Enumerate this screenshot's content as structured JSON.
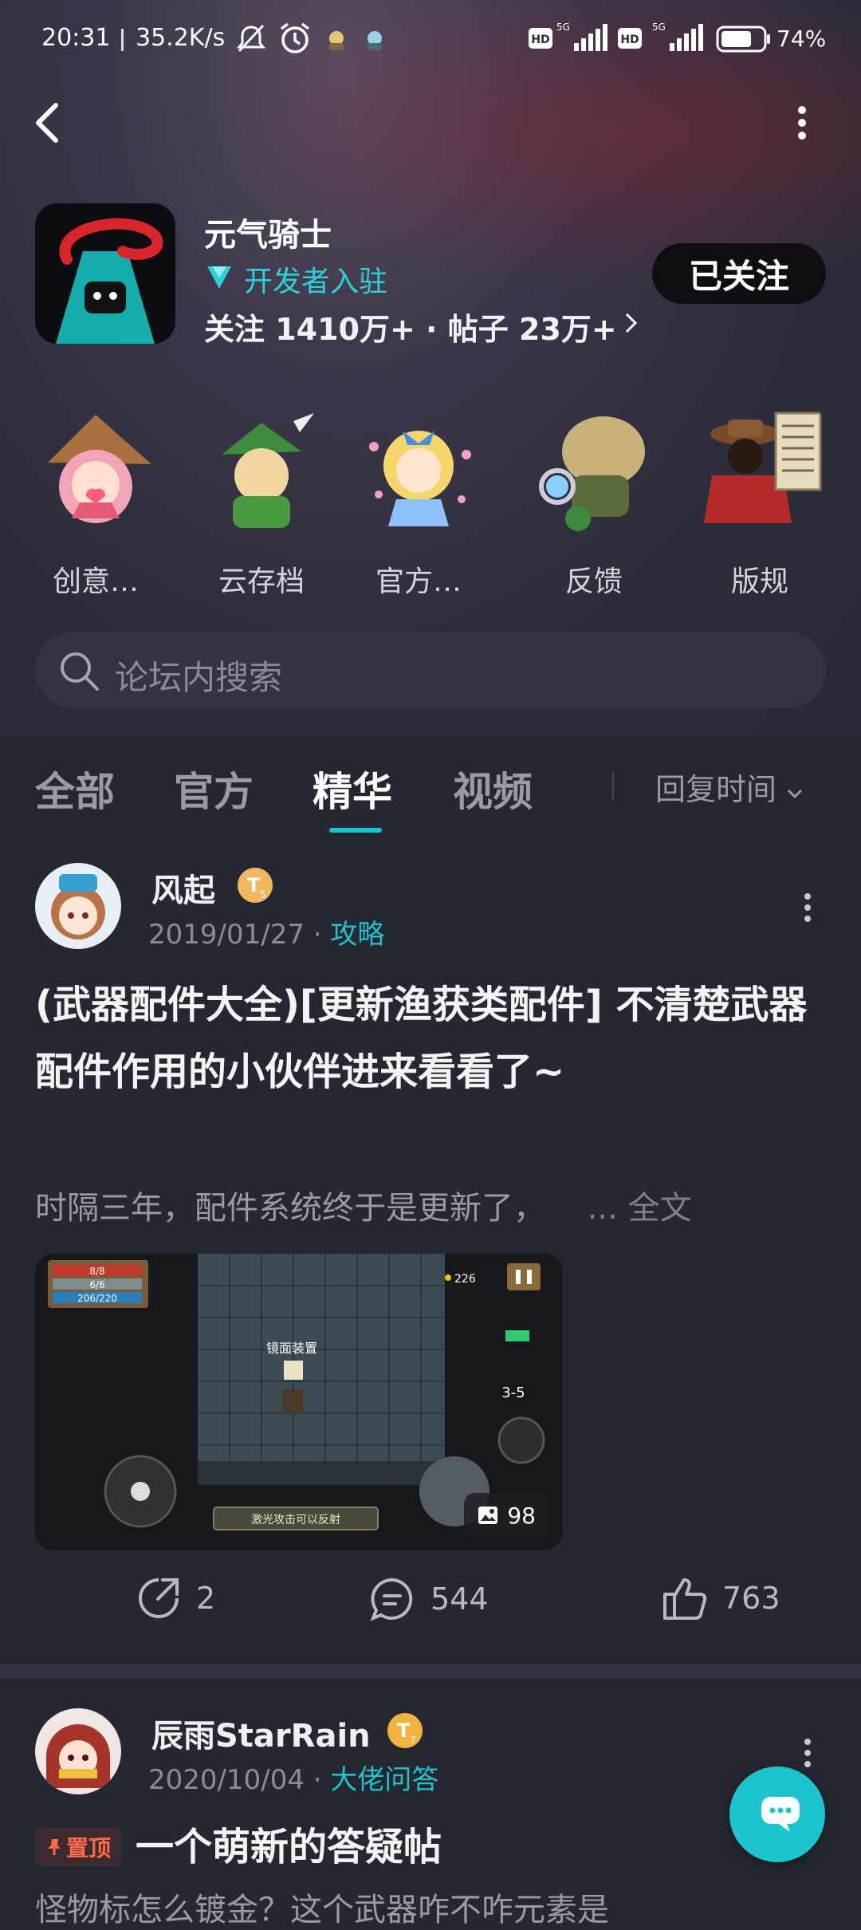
{
  "status_bar": {
    "time": "20:31",
    "speed": "35.2K/s",
    "battery": "74%",
    "icons": [
      "mute-icon",
      "alarm-icon",
      "app-icon",
      "app-icon",
      "hd-icon",
      "signal-5g-icon",
      "hd-icon",
      "signal-5g-icon",
      "battery-icon"
    ]
  },
  "forum": {
    "name": "元气骑士",
    "badge": "开发者入驻",
    "stats": "关注 1410万+ · 帖子 23万+",
    "follow_label": "已关注"
  },
  "shortcuts": [
    {
      "label": "创意…"
    },
    {
      "label": "云存档"
    },
    {
      "label": "官方…"
    },
    {
      "label": "反馈"
    },
    {
      "label": "版规"
    }
  ],
  "search": {
    "placeholder": "论坛内搜索"
  },
  "tabs": [
    {
      "label": "全部"
    },
    {
      "label": "官方"
    },
    {
      "label": "精华"
    },
    {
      "label": "视频"
    }
  ],
  "active_tab": "精华",
  "sort_label": "回复时间",
  "posts": [
    {
      "author": "风起",
      "level": "5",
      "date": "2019/01/27",
      "category": "攻略",
      "title": "(武器配件大全)[更新渔获类配件] 不清楚武器配件作用的小伙伴进来看看了~",
      "excerpt": "时隔三年，配件系统终于是更新了，",
      "more_label": "... 全文",
      "image_count": "98",
      "game_hud": {
        "hp": "8/8",
        "armor": "6/6",
        "energy": "206/220",
        "coins": "226",
        "level": "3-5",
        "weapon_name": "镜面装置",
        "tip": "激光攻击可以反射"
      },
      "shares": "2",
      "comments": "544",
      "likes": "763"
    },
    {
      "author": "辰雨StarRain",
      "level": "7",
      "date": "2020/10/04",
      "category": "大佬问答",
      "pin_label": "置顶",
      "title": "一个萌新的答疑帖",
      "excerpt": "怪物标怎么镀金？这个武器咋不咋元素是"
    }
  ],
  "colors": {
    "accent": "#1cc4cf",
    "background": "#252731",
    "pin": "#ff6b4a"
  }
}
